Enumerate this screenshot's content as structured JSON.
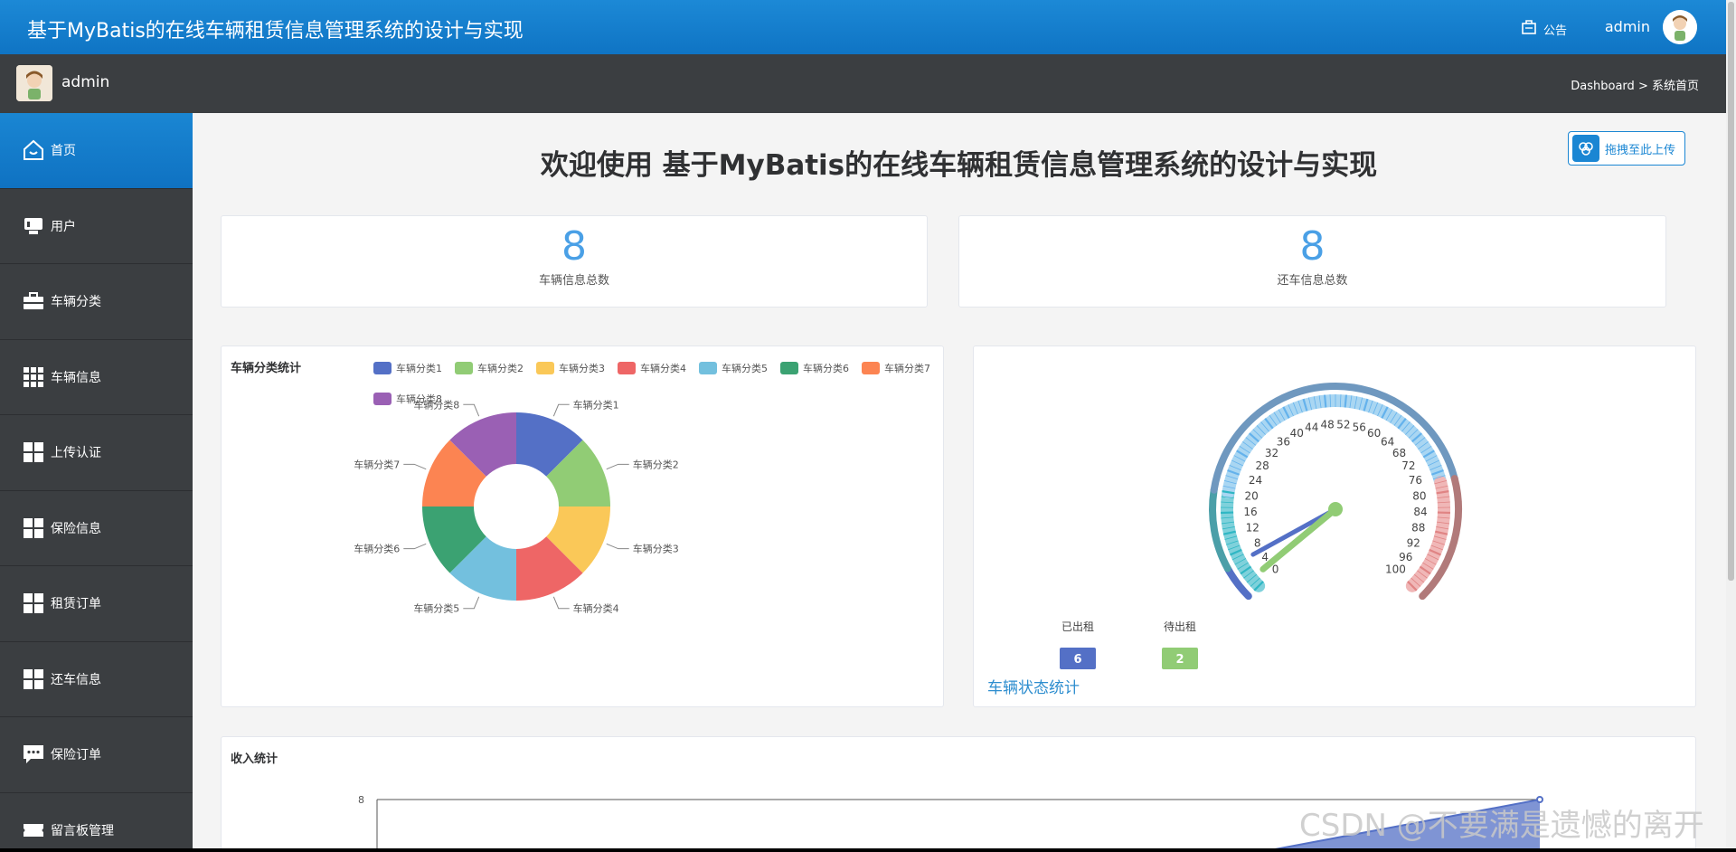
{
  "app": {
    "title": "基于MyBatis的在线车辆租赁信息管理系统的设计与实现",
    "notice_label": "公告",
    "user": "admin"
  },
  "subheader": {
    "user": "admin",
    "breadcrumb": [
      "Dashboard",
      ">",
      "系统首页"
    ]
  },
  "sidebar": {
    "items": [
      {
        "label": "首页",
        "icon": "home-icon",
        "active": true
      },
      {
        "label": "用户",
        "icon": "monitor-icon",
        "active": false
      },
      {
        "label": "车辆分类",
        "icon": "briefcase-icon",
        "active": false
      },
      {
        "label": "车辆信息",
        "icon": "grid-icon",
        "active": false
      },
      {
        "label": "上传认证",
        "icon": "grid-icon",
        "active": false
      },
      {
        "label": "保险信息",
        "icon": "grid-icon",
        "active": false
      },
      {
        "label": "租赁订单",
        "icon": "grid-icon",
        "active": false
      },
      {
        "label": "还车信息",
        "icon": "grid-icon",
        "active": false
      },
      {
        "label": "保险订单",
        "icon": "chat-icon",
        "active": false
      },
      {
        "label": "留言板管理",
        "icon": "ticket-icon",
        "active": false
      }
    ]
  },
  "main": {
    "welcome": "欢迎使用 基于MyBatis的在线车辆租赁信息管理系统的设计与实现",
    "upload_button": "拖拽至此上传",
    "stats": [
      {
        "value": "8",
        "label": "车辆信息总数"
      },
      {
        "value": "8",
        "label": "还车信息总数"
      }
    ],
    "pie_title": "车辆分类统计",
    "gauge_title": "车辆状态统计",
    "income_title": "收入统计"
  },
  "colors": {
    "primary": "#1a86d3",
    "sidebar": "#3b3e41",
    "stat_number": "#4aa0e6"
  },
  "watermark": "CSDN @不要满是遗憾的离开",
  "chart_data": [
    {
      "type": "pie",
      "title": "车辆分类统计",
      "categories": [
        "车辆分类1",
        "车辆分类2",
        "车辆分类3",
        "车辆分类4",
        "车辆分类5",
        "车辆分类6",
        "车辆分类7",
        "车辆分类8"
      ],
      "values": [
        1,
        1,
        1,
        1,
        1,
        1,
        1,
        1
      ],
      "colors": [
        "#5470c6",
        "#91cc75",
        "#fac858",
        "#ee6666",
        "#73c0de",
        "#3ba272",
        "#fc8452",
        "#9a60b4"
      ],
      "legend": "top"
    },
    {
      "type": "gauge",
      "title": "车辆状态统计",
      "min": 0,
      "max": 100,
      "ticks": [
        0,
        4,
        8,
        12,
        16,
        20,
        24,
        28,
        32,
        36,
        40,
        44,
        48,
        52,
        56,
        60,
        64,
        68,
        72,
        76,
        80,
        84,
        88,
        92,
        96,
        100
      ],
      "series": [
        {
          "name": "已出租",
          "value": 6,
          "color": "#5470c6"
        },
        {
          "name": "待出租",
          "value": 2,
          "color": "#91cc75"
        }
      ]
    },
    {
      "type": "area",
      "title": "收入统计",
      "y_ticks": [
        8
      ],
      "color": "#5470c6"
    }
  ]
}
